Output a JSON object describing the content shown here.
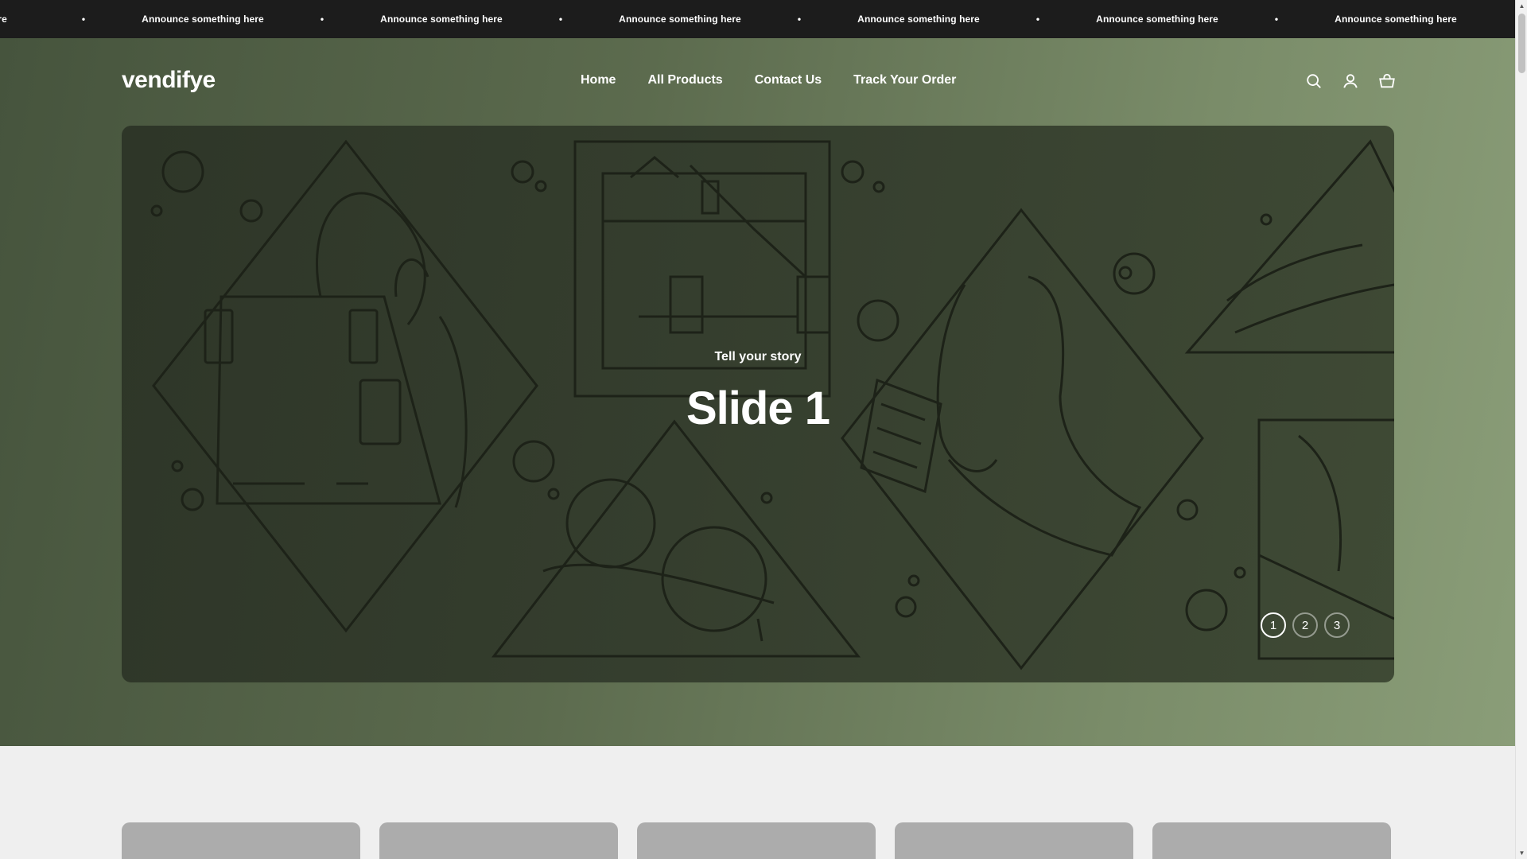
{
  "announcement": {
    "text": "Announce something here",
    "items": [
      "ce something here",
      "Announce something here",
      "Announce something here",
      "Announce something here",
      "Announce something here",
      "Announce something here",
      "Announce something here"
    ],
    "separator": "•"
  },
  "header": {
    "logo": "vendifye",
    "nav": [
      "Home",
      "All Products",
      "Contact Us",
      "Track Your Order"
    ],
    "icons": [
      "search-icon",
      "account-icon",
      "cart-icon"
    ]
  },
  "hero": {
    "subheading": "Tell your story",
    "title": "Slide 1",
    "dots": [
      "1",
      "2",
      "3"
    ],
    "active_dot": 0
  },
  "colors": {
    "announcement_bg": "#1c1c1c",
    "hero_gradient_start": "#46543d",
    "hero_gradient_end": "#8a9d78",
    "slide_bg": "#353e2e",
    "card_placeholder": "#acacac"
  }
}
